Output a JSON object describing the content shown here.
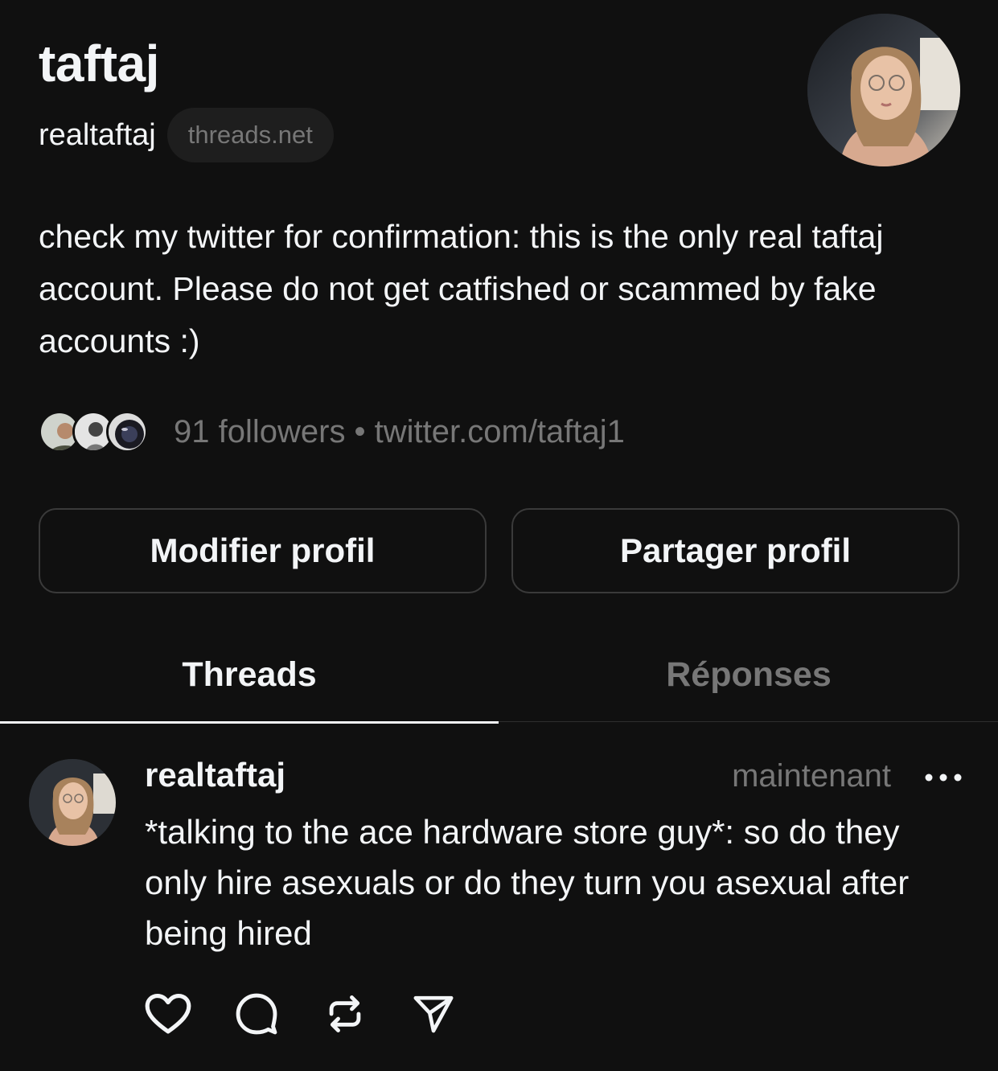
{
  "profile": {
    "name": "taftaj",
    "handle": "realtaftaj",
    "domain_chip": "threads.net",
    "bio": "check my twitter for confirmation: this is the only real taftaj account. Please do not get catfished or scammed by fake accounts :)",
    "followers_line": "91 followers • twitter.com/taftaj1",
    "avatar_icon": "profile-photo",
    "follower_avatar_icons": [
      "follower-photo-1",
      "follower-photo-2",
      "follower-photo-3"
    ]
  },
  "buttons": {
    "edit": "Modifier profil",
    "share": "Partager profil"
  },
  "tabs": [
    {
      "label": "Threads",
      "active": true
    },
    {
      "label": "Réponses",
      "active": false
    }
  ],
  "post": {
    "user": "realtaftaj",
    "time": "maintenant",
    "text": "*talking to the ace hardware store guy*: so do they only hire asexuals or do they turn you asexual after being hired",
    "actions": [
      "heart-icon",
      "comment-icon",
      "repost-icon",
      "send-icon"
    ]
  },
  "colors": {
    "background": "#101010",
    "text": "#f3f5f7",
    "muted": "#777777",
    "border": "#3a3a3a"
  }
}
